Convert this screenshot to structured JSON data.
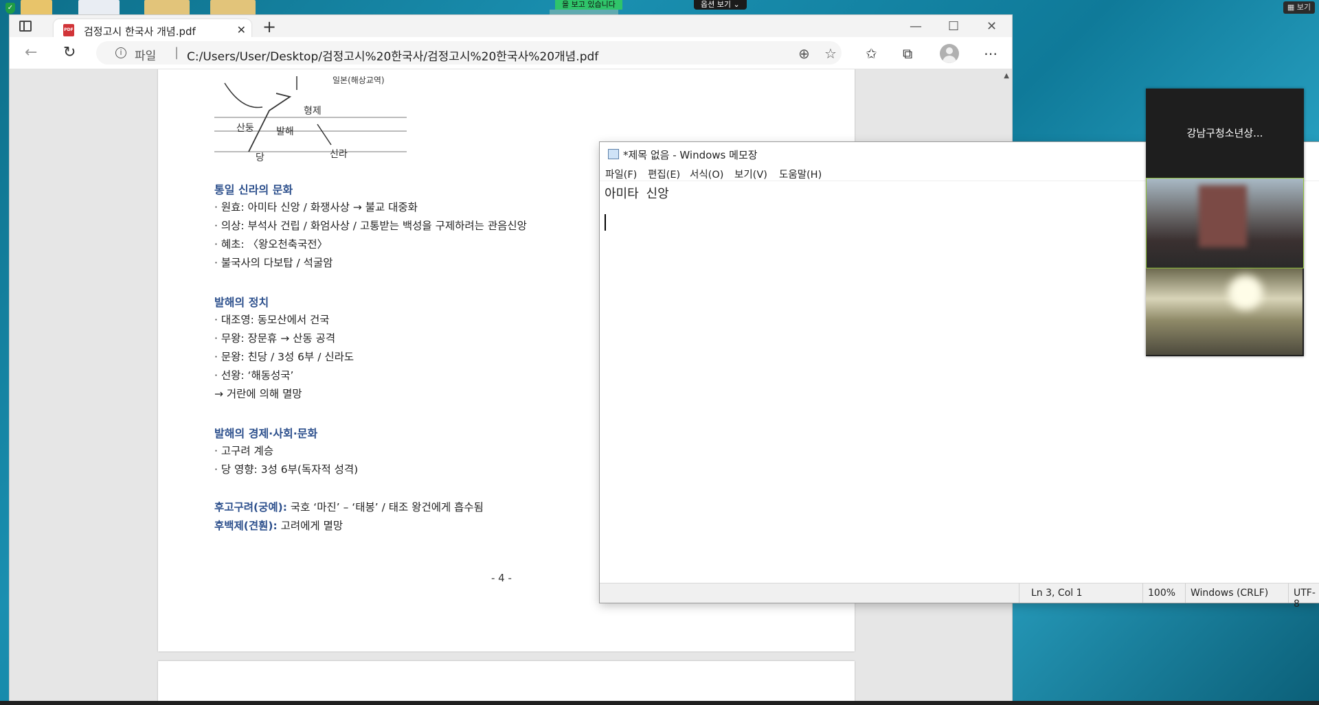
{
  "desktop": {
    "zoom_notice": "을 보고 있습니다",
    "zoom_options": "옵션 보기 ⌄",
    "zoom_view": "보기"
  },
  "browser": {
    "tab_title": "검정고시 한국사 개념.pdf",
    "address_label": "파일",
    "url": "C:/Users/User/Desktop/검정고시%20한국사/검정고시%20한국사%20개념.pdf"
  },
  "pdf": {
    "sketch_labels": [
      "산둥",
      "발해",
      "당",
      "신라",
      "일본(해상교역)",
      "형제"
    ],
    "sections": [
      {
        "heading": "통일 신라의 문화",
        "lines": [
          "· 원효: 아미타 신앙 / 화쟁사상 → 불교 대중화",
          "· 의상: 부석사 건립 / 화엄사상 / 고통받는 백성을 구제하려는 관음신앙",
          "· 혜초: 〈왕오천축국전〉",
          "· 불국사의 다보탑 / 석굴암"
        ]
      },
      {
        "heading": "발해의 정치",
        "lines": [
          "· 대조영: 동모산에서 건국",
          "· 무왕: 장문휴 → 산동 공격",
          "· 문왕: 친당 / 3성 6부 / 신라도",
          "· 선왕: ‘해동성국’",
          "→ 거란에 의해 멸망"
        ]
      },
      {
        "heading": "발해의 경제·사회·문화",
        "lines": [
          "· 고구려 계승",
          "· 당 영향: 3성 6부(독자적 성격)"
        ]
      }
    ],
    "later": [
      {
        "label": "후고구려(궁예):",
        "text": " 국호 ‘마진’ – ‘태봉’ / 태조 왕건에게 흡수됨"
      },
      {
        "label": "후백제(견훤):",
        "text": " 고려에게 멸망"
      }
    ],
    "page_number": "- 4 -"
  },
  "notepad": {
    "title": "*제목 없음 - Windows 메모장",
    "menu": [
      "파일(F)",
      "편집(E)",
      "서식(O)",
      "보기(V)",
      "도움말(H)"
    ],
    "content": "아미타 신앙",
    "status": {
      "position": "Ln 3, Col 1",
      "zoom": "100%",
      "line_ending": "Windows (CRLF)",
      "encoding": "UTF-8"
    }
  },
  "zoom_panel": {
    "name": "강남구청소년상..."
  },
  "colors": {
    "pdf_heading": "#2c4f8c",
    "zoom_green": "#2fc46a",
    "pdf_icon_red": "#d13438"
  }
}
